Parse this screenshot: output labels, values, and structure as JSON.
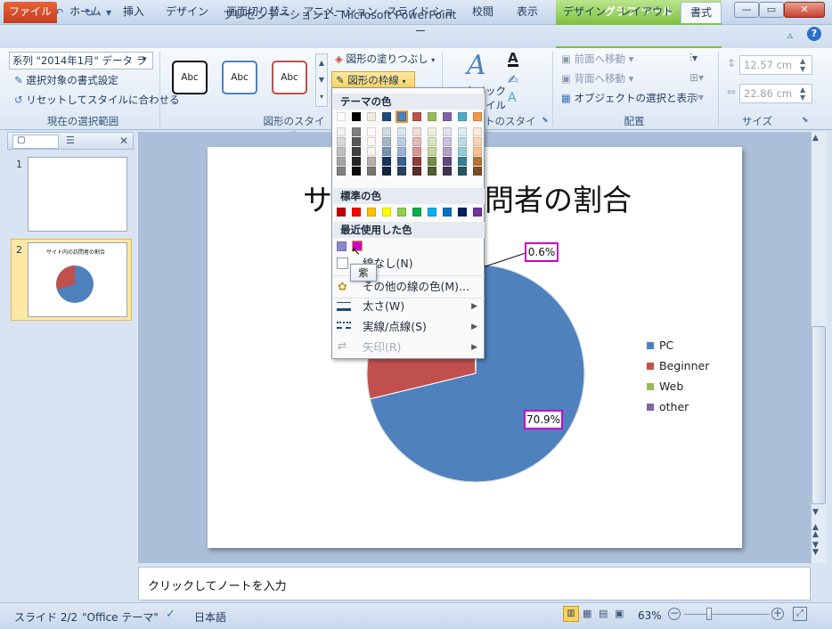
{
  "window": {
    "title": "プレゼンテーション1 - Microsoft PowerPoint",
    "context_tab": "グラフ ツール"
  },
  "tabs": [
    "ファイル",
    "ホーム",
    "挿入",
    "デザイン",
    "画面切り替え",
    "アニメーション",
    "スライド ショー",
    "校閲",
    "表示",
    "デザイン",
    "レイアウト",
    "書式"
  ],
  "ribbon": {
    "selection_dropdown": "系列 \"2014年1月\" データ ラ",
    "format_selection": "選択対象の書式設定",
    "reset_style": "リセットしてスタイルに合わせる",
    "group_current_selection": "現在の選択範囲",
    "style_sample": "Abc",
    "group_shape_styles": "図形のスタイル",
    "shape_fill": "図形の塗りつぶし",
    "shape_outline": "図形の枠線",
    "quick_styles_line1": "クイック",
    "quick_styles_line2": "スタイル",
    "group_wordart": "トのスタイル",
    "bring_forward": "前面へ移動",
    "send_backward": "背面へ移動",
    "selection_pane": "オブジェクトの選択と表示",
    "group_arrange": "配置",
    "height": "12.57 cm",
    "width": "22.86 cm",
    "group_size": "サイズ"
  },
  "slides_panel": {
    "slide1_num": "1",
    "slide2_num": "2",
    "thumb2_title": "サイト内の訪問者の割合"
  },
  "slide": {
    "title_left": "サ",
    "title_right": "問者の割合",
    "label_small": "0.6%",
    "label_pc": "70.9%",
    "legend": [
      {
        "name": "PC",
        "color": "#4f81bd"
      },
      {
        "name": "Beginner",
        "color": "#c0504d"
      },
      {
        "name": "Web",
        "color": "#9bbb59"
      },
      {
        "name": "other",
        "color": "#8064a2"
      }
    ]
  },
  "chart_data": {
    "type": "pie",
    "categories": [
      "PC",
      "Beginner",
      "Web",
      "other"
    ],
    "values": [
      70.9,
      28.5,
      0.0,
      0.6
    ],
    "colors": [
      "#4f81bd",
      "#c0504d",
      "#9bbb59",
      "#8064a2"
    ],
    "data_labels": [
      "70.9%",
      "",
      "",
      "0.6%"
    ],
    "legend_position": "right"
  },
  "menu": {
    "theme_colors": "テーマの色",
    "standard_colors": "標準の色",
    "recent_colors": "最近使用した色",
    "no_line": "線なし(N)",
    "more_colors": "その他の線の色(M)...",
    "weight": "太さ(W)",
    "dashes": "実線/点線(S)",
    "arrows": "矢印(R)",
    "tooltip": "紫",
    "theme_top": [
      "#ffffff",
      "#000000",
      "#eeece1",
      "#1f497d",
      "#4f81bd",
      "#c0504d",
      "#9bbb59",
      "#8064a2",
      "#4bacc6",
      "#f79646"
    ],
    "standard": [
      "#c00000",
      "#ff0000",
      "#ffc000",
      "#ffff00",
      "#92d050",
      "#00b050",
      "#00b0f0",
      "#0070c0",
      "#002060",
      "#7030a0"
    ],
    "recent": [
      "#8b88c9",
      "#cc00cc"
    ]
  },
  "notes": {
    "placeholder": "クリックしてノートを入力"
  },
  "status": {
    "slide": "スライド 2/2",
    "theme": "\"Office テーマ\"",
    "language": "日本語",
    "zoom": "63%"
  }
}
